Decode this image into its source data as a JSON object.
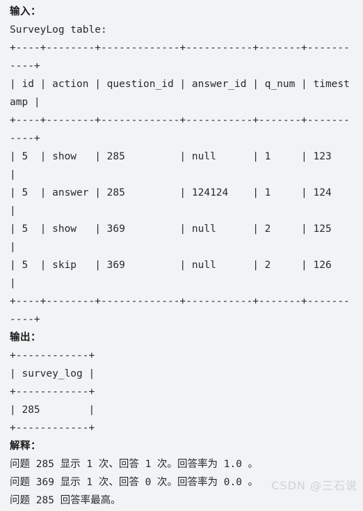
{
  "background_color": "#f2f3f5",
  "text_color": "#24292e",
  "watermark_color": "#cfd2d6",
  "input_section": {
    "heading": "输入：",
    "table_caption": "SurveyLog table:",
    "separator": "+----+--------+-------------+-----------+-------+-----------+",
    "header_row": "| id | action | question_id | answer_id | q_num | timestamp |",
    "rows": [
      "| 5  | show   | 285         | null      | 1     | 123       |",
      "| 5  | answer | 285         | 124124    | 1     | 124       |",
      "| 5  | show   | 369         | null      | 2     | 125       |",
      "| 5  | skip   | 369         | null      | 2     | 126       |"
    ],
    "columns": [
      "id",
      "action",
      "question_id",
      "answer_id",
      "q_num",
      "timestamp"
    ],
    "data": [
      {
        "id": "5",
        "action": "show",
        "question_id": "285",
        "answer_id": "null",
        "q_num": "1",
        "timestamp": "123"
      },
      {
        "id": "5",
        "action": "answer",
        "question_id": "285",
        "answer_id": "124124",
        "q_num": "1",
        "timestamp": "124"
      },
      {
        "id": "5",
        "action": "show",
        "question_id": "369",
        "answer_id": "null",
        "q_num": "2",
        "timestamp": "125"
      },
      {
        "id": "5",
        "action": "skip",
        "question_id": "369",
        "answer_id": "null",
        "q_num": "2",
        "timestamp": "126"
      }
    ]
  },
  "output_section": {
    "heading": "输出：",
    "separator": "+------------+",
    "header_row": "| survey_log |",
    "rows": [
      "| 285        |"
    ],
    "columns": [
      "survey_log"
    ],
    "data": [
      {
        "survey_log": "285"
      }
    ]
  },
  "explanation_section": {
    "heading": "解释：",
    "lines": [
      "问题 285 显示 1 次、回答 1 次。回答率为 1.0 。",
      "问题 369 显示 1 次、回答 0 次。回答率为 0.0 。",
      "问题 285 回答率最高。"
    ]
  },
  "watermark": "CSDN @三石说"
}
